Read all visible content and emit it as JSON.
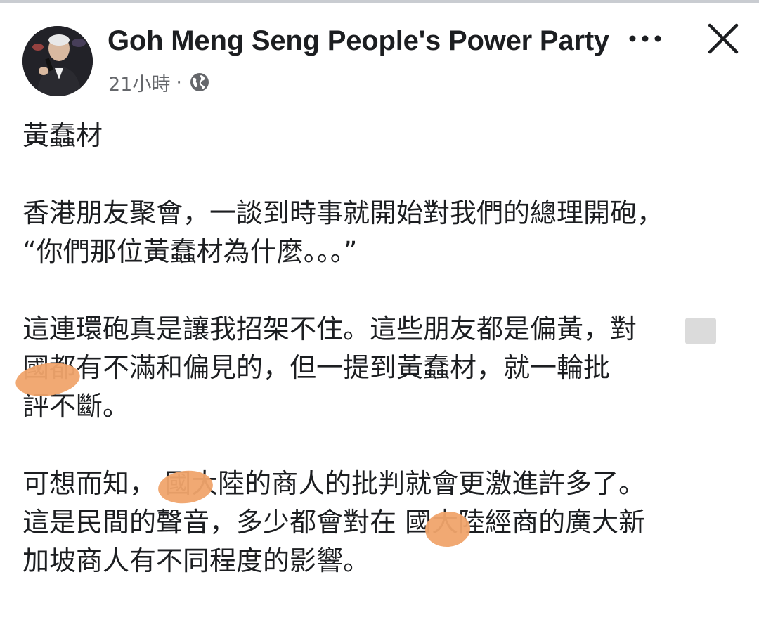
{
  "post": {
    "author": "Goh Meng Seng People's Power Party",
    "time": "21小時",
    "separator": "·",
    "privacy_icon": "globe-icon",
    "more_icon": "more-dots-icon",
    "close_icon": "close-icon"
  },
  "content": {
    "title": "黃蠢材",
    "para1": "香港朋友聚會，一談到時事就開始對我們的總理開砲，\n“你們那位黃蠢材為什麼。。。”",
    "para2": "這連環砲真是讓我招架不住。這些朋友都是偏黃，對\n國都有不滿和偏見的，但一提到黃蠢材，就一輪批\n評不斷。",
    "para3": "可想而知，     國大陸的商人的批判就會更激進許多了。\n這是民間的聲音，多少都會對在   國大陸經商的廣大新\n加坡商人有不同程度的影響。"
  },
  "colors": {
    "redaction": "#f0a46b",
    "text": "#1c1e21",
    "secondary": "#65676b"
  }
}
